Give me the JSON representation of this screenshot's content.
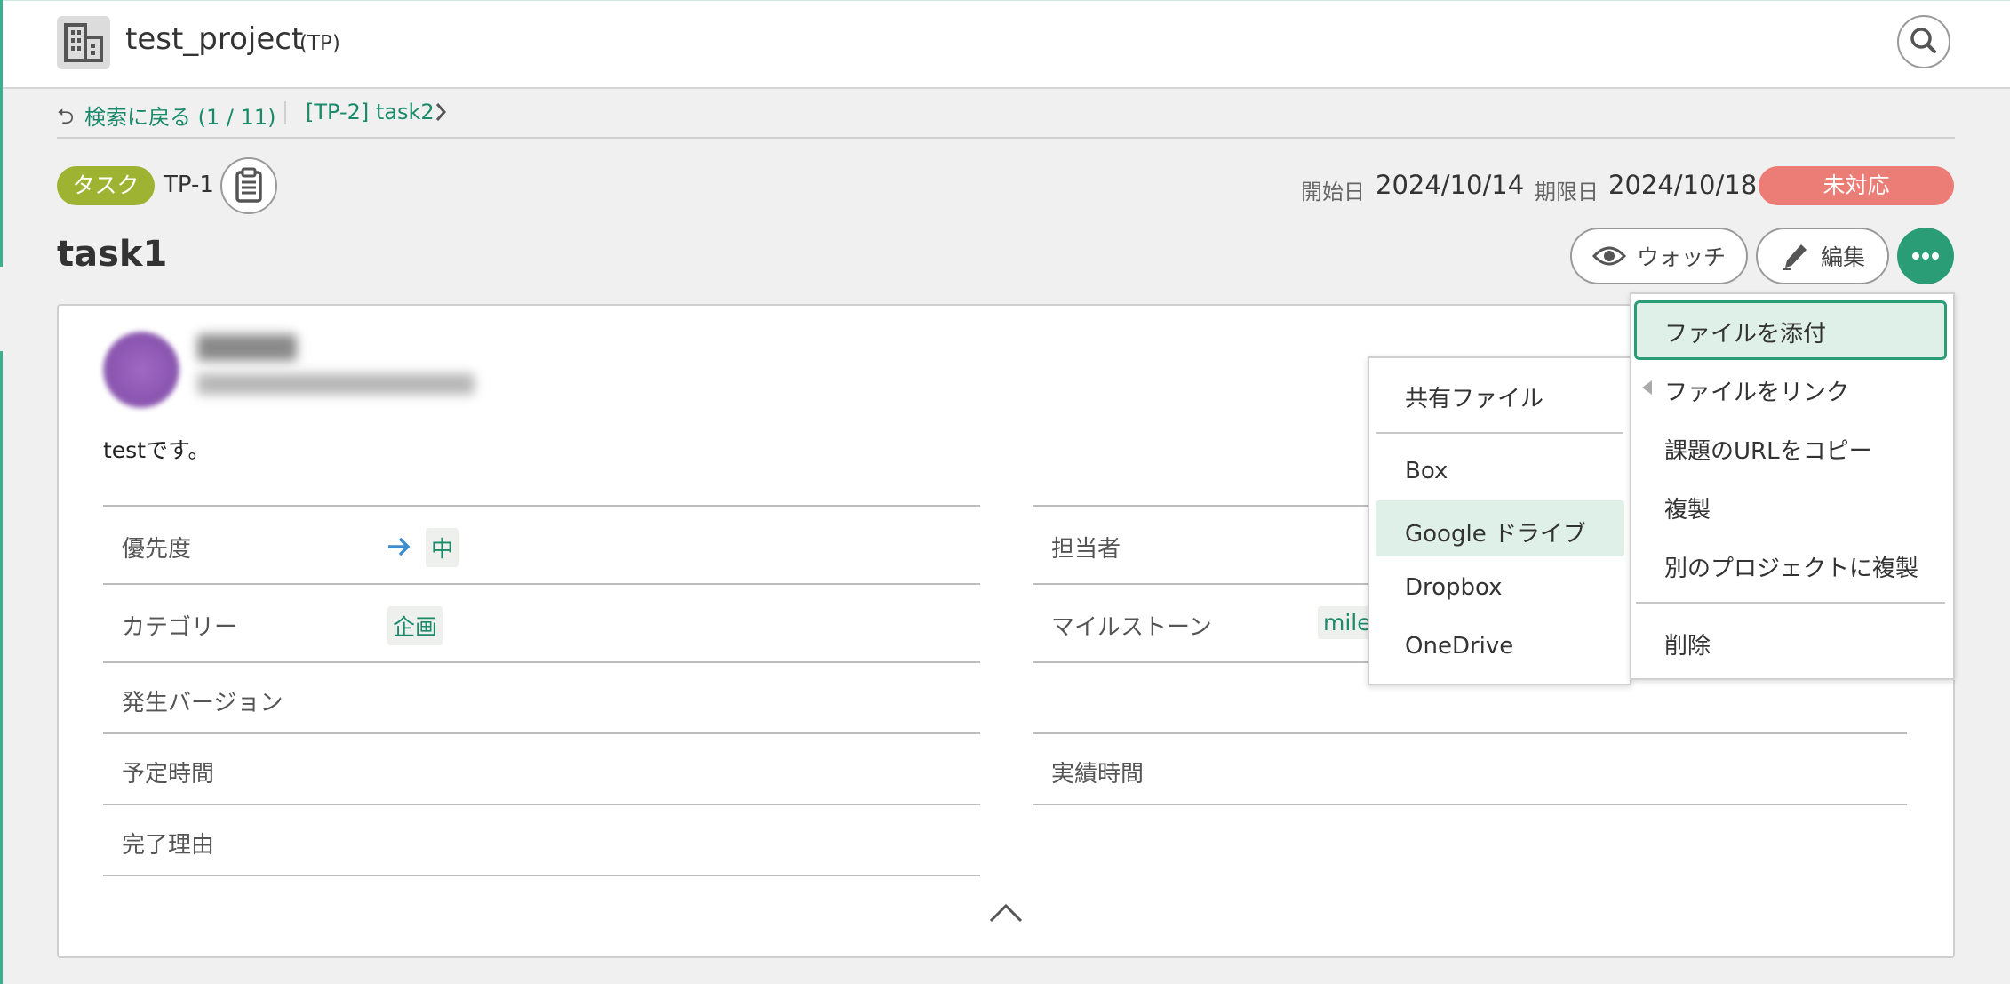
{
  "header": {
    "project_name": "test_project",
    "project_key": "(TP)"
  },
  "breadcrumb": {
    "back_label": "検索に戻る (1 / 11)",
    "next_label": "[TP-2] task2"
  },
  "issue": {
    "type": "タスク",
    "key": "TP-1",
    "start_label": "開始日",
    "start_date": "2024/10/14",
    "due_label": "期限日",
    "due_date": "2024/10/18",
    "status": "未対応",
    "title": "task1",
    "description": "testです。"
  },
  "actions": {
    "watch_label": "ウォッチ",
    "edit_label": "編集"
  },
  "properties": {
    "priority_label": "優先度",
    "priority_value": "中",
    "assignee_label": "担当者",
    "category_label": "カテゴリー",
    "category_value": "企画",
    "milestone_label": "マイルストーン",
    "milestone_value": "mile",
    "version_label": "発生バージョン",
    "estimated_label": "予定時間",
    "actual_label": "実績時間",
    "resolution_label": "完了理由"
  },
  "action_menu": {
    "items": [
      "ファイルを添付",
      "ファイルをリンク",
      "課題のURLをコピー",
      "複製",
      "別のプロジェクトに複製",
      "削除"
    ]
  },
  "file_submenu": {
    "items": [
      "共有ファイル",
      "Box",
      "Google ドライブ",
      "Dropbox",
      "OneDrive"
    ]
  },
  "colors": {
    "accent": "#2a9d77",
    "link": "#1b8a6b",
    "type_badge": "#9fb332",
    "status_badge": "#ec7c76",
    "menu_highlight": "#dff0e8"
  }
}
